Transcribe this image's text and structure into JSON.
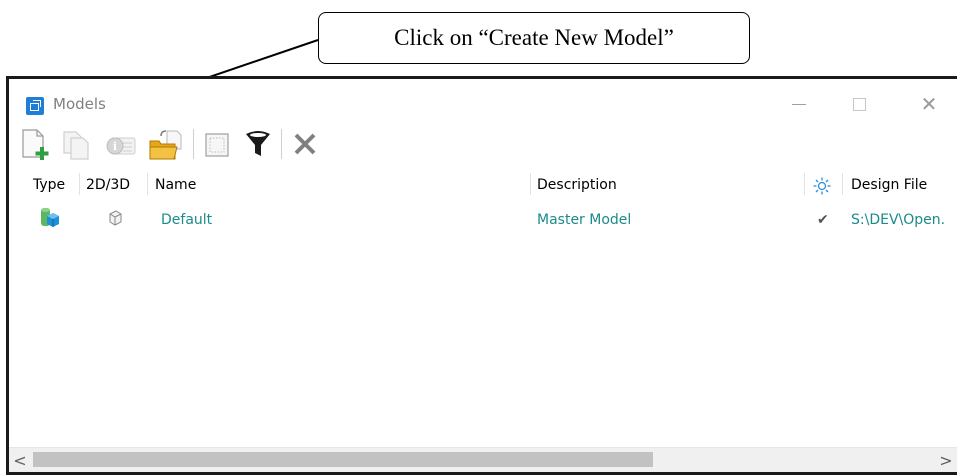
{
  "annotation": {
    "callout_text": "Click on “Create New Model”"
  },
  "window": {
    "title": "Models",
    "controls": {
      "minimize": "minimize",
      "maximize": "maximize",
      "close": "close"
    }
  },
  "toolbar": {
    "buttons": [
      {
        "name": "create-new-model",
        "icon": "new-file-plus-icon"
      },
      {
        "name": "copy-model",
        "icon": "copy-icon"
      },
      {
        "name": "model-properties",
        "icon": "properties-icon"
      },
      {
        "name": "import-model",
        "icon": "folder-import-icon"
      },
      {
        "name": "view-area",
        "icon": "selection-rect-icon"
      },
      {
        "name": "filter",
        "icon": "filter-icon"
      },
      {
        "name": "delete-model",
        "icon": "delete-icon"
      }
    ]
  },
  "table": {
    "columns": [
      "Type",
      "2D/3D",
      "Name",
      "Description",
      "Design File"
    ],
    "rows": [
      {
        "type_icon": "design-model-icon",
        "dim_icon": "3d-cube-icon",
        "name": "Default",
        "description": "Master Model",
        "check": "✔",
        "design_file": "S:\\DEV\\Open."
      }
    ]
  },
  "scrollbar": {
    "left": "<",
    "right": ">"
  },
  "colors": {
    "accent": "#1f7fd6",
    "link_text": "#1c8a8a",
    "plus_green": "#2ea043"
  }
}
